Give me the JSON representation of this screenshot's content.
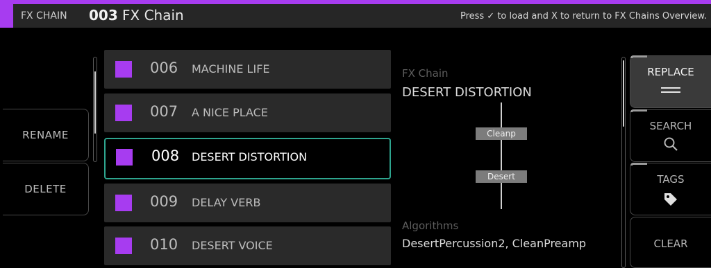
{
  "header": {
    "label": "FX CHAIN",
    "number": "003",
    "title": "FX Chain",
    "hint": "Press ✓ to load and X to return to FX Chains Overview."
  },
  "left_actions": [
    {
      "label": "RENAME"
    },
    {
      "label": "DELETE"
    }
  ],
  "list": {
    "items": [
      {
        "number": "006",
        "name": "MACHINE LIFE",
        "selected": false
      },
      {
        "number": "007",
        "name": "A NICE PLACE",
        "selected": false
      },
      {
        "number": "008",
        "name": "DESERT DISTORTION",
        "selected": true
      },
      {
        "number": "009",
        "name": "DELAY VERB",
        "selected": false
      },
      {
        "number": "010",
        "name": "DESERT VOICE",
        "selected": false
      }
    ]
  },
  "details": {
    "section_label": "FX Chain",
    "name": "DESERT DISTORTION",
    "chain_blocks": [
      "Cleanp",
      "Desert"
    ],
    "algorithms_label": "Algorithms",
    "algorithms": "DesertPercussion2, CleanPreamp"
  },
  "right_actions": [
    {
      "label": "REPLACE",
      "icon": "menu-lines-icon",
      "active": true
    },
    {
      "label": "SEARCH",
      "icon": "search-icon",
      "active": false
    },
    {
      "label": "TAGS",
      "icon": "tag-icon",
      "active": false
    },
    {
      "label": "CLEAR",
      "icon": "",
      "active": false
    }
  ],
  "colors": {
    "accent": "#a73cf0",
    "selection": "#2ea58f",
    "row_bg": "#2a2a2a",
    "header_bg": "#262626"
  }
}
